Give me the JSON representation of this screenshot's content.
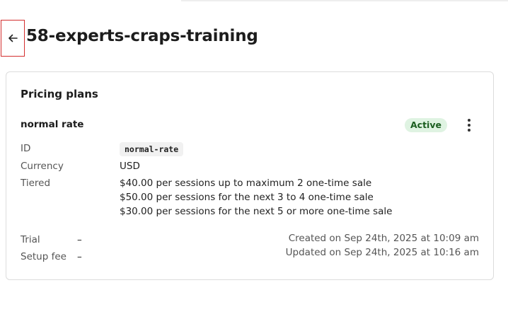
{
  "header": {
    "title": "58-experts-craps-training",
    "back_icon": "arrow-left-icon"
  },
  "card": {
    "title": "Pricing plans",
    "plan": {
      "name": "normal rate",
      "status": "Active",
      "status_color": "#dff3e2",
      "menu_icon": "more-vertical-icon",
      "fields": {
        "id_label": "ID",
        "id_value": "normal-rate",
        "currency_label": "Currency",
        "currency_value": "USD",
        "tiered_label": "Tiered",
        "tiers": [
          "$40.00 per sessions up to maximum 2 one-time sale",
          "$50.00 per sessions for the next 3 to 4 one-time sale",
          "$30.00 per sessions for the next 5 or more one-time sale"
        ]
      },
      "trial_label": "Trial",
      "trial_value": "–",
      "setup_fee_label": "Setup fee",
      "setup_fee_value": "–",
      "created": "Created on Sep 24th, 2025 at 10:09 am",
      "updated": "Updated on Sep 24th, 2025 at 10:16 am"
    }
  }
}
